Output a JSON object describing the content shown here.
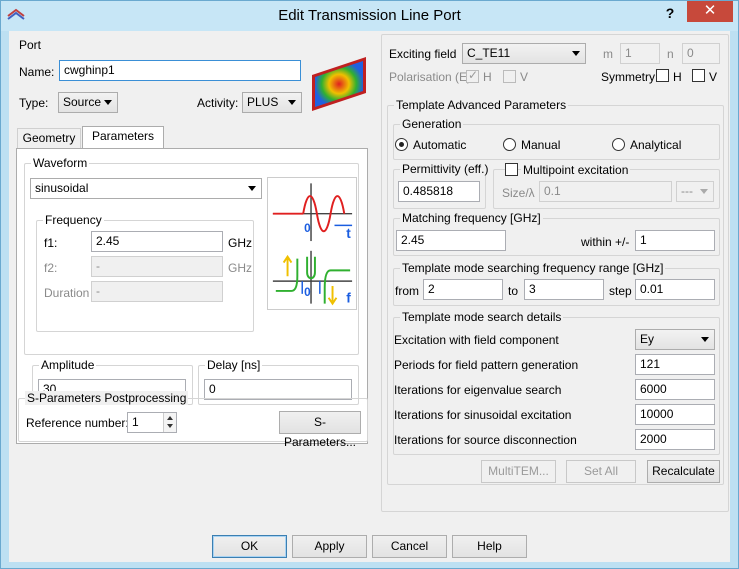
{
  "window": {
    "title": "Edit Transmission Line Port",
    "help_glyph": "?",
    "close_glyph": "✕"
  },
  "port": {
    "group_label": "Port",
    "name_label": "Name:",
    "name_value": "cwghinp1",
    "type_label": "Type:",
    "type_value": "Source",
    "activity_label": "Activity:",
    "activity_value": "PLUS"
  },
  "tabs": [
    {
      "label": "Geometry"
    },
    {
      "label": "Parameters"
    }
  ],
  "waveform": {
    "group_label": "Waveform",
    "value": "sinusoidal",
    "frequency": {
      "group_label": "Frequency",
      "f1_label": "f1:",
      "f1_value": "2.45",
      "f1_unit": "GHz",
      "f2_label": "f2:",
      "f2_value": "-",
      "f2_unit": "GHz",
      "duration_label": "Duration",
      "duration_value": "-"
    },
    "amplitude_label": "Amplitude",
    "amplitude_value": "30",
    "delay_label": "Delay [ns]",
    "delay_value": "0",
    "graph_t_label": "t",
    "graph_f_label": "f",
    "graph_zero_1": "0",
    "graph_zero_2": "0"
  },
  "sparams": {
    "group_label": "S-Parameters Postprocessing",
    "ref_label": "Reference number:",
    "ref_value": "1",
    "button_label": "S-Parameters..."
  },
  "exciting": {
    "field_label": "Exciting field",
    "field_value": "C_TE11",
    "m_label": "m",
    "m_value": "1",
    "n_label": "n",
    "n_value": "0",
    "polarisation_label": "Polarisation (E)",
    "pol_h_label": "H",
    "pol_v_label": "V",
    "symmetry_label": "Symmetry",
    "sym_h_label": "H",
    "sym_v_label": "V"
  },
  "template": {
    "group_label": "Template Advanced Parameters",
    "generation": {
      "group_label": "Generation",
      "automatic": "Automatic",
      "manual": "Manual",
      "analytical": "Analytical",
      "selected": "Automatic"
    },
    "permittivity_label": "Permittivity (eff.)",
    "permittivity_value": "0.485818",
    "multipoint_label": "Multipoint excitation",
    "size_label": "Size/λ",
    "size_value": "0.1",
    "size_combo": "---",
    "matching": {
      "group_label": "Matching frequency [GHz]",
      "value": "2.45",
      "within_label": "within +/-",
      "within_value": "1"
    },
    "search_range": {
      "group_label": "Template mode searching frequency range [GHz]",
      "from_label": "from",
      "from_value": "2",
      "to_label": "to",
      "to_value": "3",
      "step_label": "step",
      "step_value": "0.01"
    },
    "details": {
      "group_label": "Template mode search details",
      "rows": [
        {
          "label": "Excitation with field component",
          "value": "Ey"
        },
        {
          "label": "Periods for field pattern generation",
          "value": "121"
        },
        {
          "label": "Iterations for eigenvalue search",
          "value": "6000"
        },
        {
          "label": "Iterations for sinusoidal excitation",
          "value": "10000"
        },
        {
          "label": "Iterations for source disconnection",
          "value": "2000"
        }
      ]
    },
    "multitem_label": "MultiTEM...",
    "setall_label": "Set All",
    "recalc_label": "Recalculate"
  },
  "footer": {
    "ok": "OK",
    "apply": "Apply",
    "cancel": "Cancel",
    "help": "Help"
  }
}
